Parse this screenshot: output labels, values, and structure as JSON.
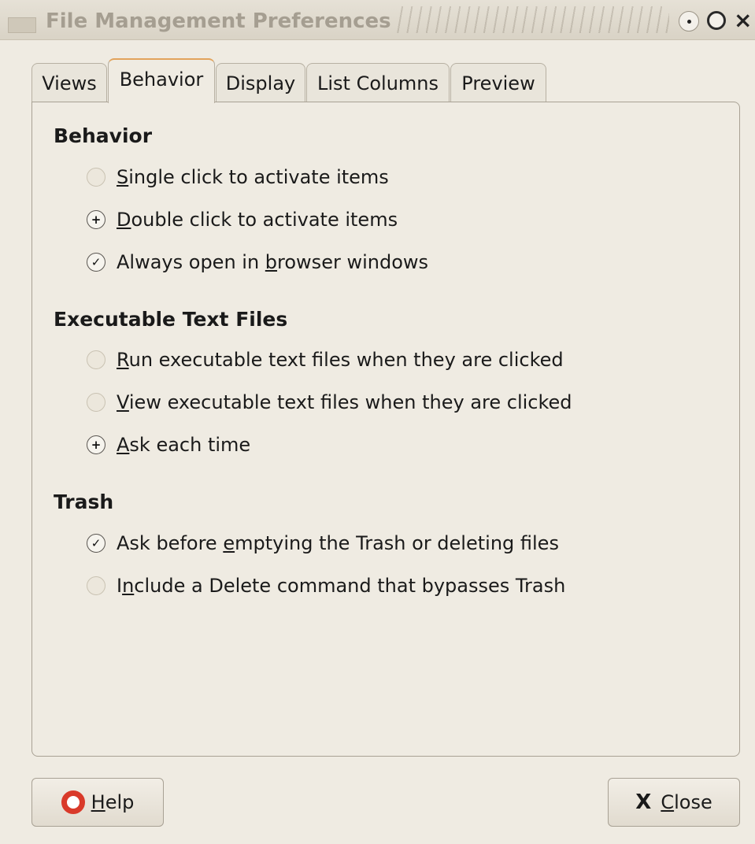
{
  "window": {
    "title": "File Management Preferences",
    "controls": {
      "minimize": "•",
      "maximize": "O",
      "close": "×"
    }
  },
  "tabs": [
    {
      "label": "Views",
      "active": false
    },
    {
      "label": "Behavior",
      "active": true
    },
    {
      "label": "Display",
      "active": false
    },
    {
      "label": "List Columns",
      "active": false
    },
    {
      "label": "Preview",
      "active": false
    }
  ],
  "sections": {
    "behavior": {
      "title": "Behavior",
      "options": [
        {
          "pre": "",
          "mn": "S",
          "post": "ingle click to activate items",
          "type": "radio",
          "checked": false
        },
        {
          "pre": "",
          "mn": "D",
          "post": "ouble click to activate items",
          "type": "radio",
          "checked": true
        },
        {
          "pre": "Always open in ",
          "mn": "b",
          "post": "rowser windows",
          "type": "checkbox",
          "checked": true
        }
      ]
    },
    "executable": {
      "title": "Executable Text Files",
      "options": [
        {
          "pre": "",
          "mn": "R",
          "post": "un executable text files when they are clicked",
          "type": "radio",
          "checked": false
        },
        {
          "pre": "",
          "mn": "V",
          "post": "iew executable text files when they are clicked",
          "type": "radio",
          "checked": false
        },
        {
          "pre": "",
          "mn": "A",
          "post": "sk each time",
          "type": "radio",
          "checked": true
        }
      ]
    },
    "trash": {
      "title": "Trash",
      "options": [
        {
          "pre": "Ask before ",
          "mn": "e",
          "post": "mptying the Trash or deleting files",
          "type": "checkbox",
          "checked": true
        },
        {
          "pre": "I",
          "mn": "n",
          "post": "clude a Delete command that bypasses Trash",
          "type": "checkbox",
          "checked": false
        }
      ]
    }
  },
  "buttons": {
    "help": {
      "mn": "H",
      "rest": "elp"
    },
    "close": {
      "icon": "X",
      "mn": "C",
      "rest": "lose"
    }
  },
  "icons": {
    "help": "lifebuoy-icon",
    "close": "x-icon",
    "radio_on": "+",
    "check_on": "✓"
  }
}
